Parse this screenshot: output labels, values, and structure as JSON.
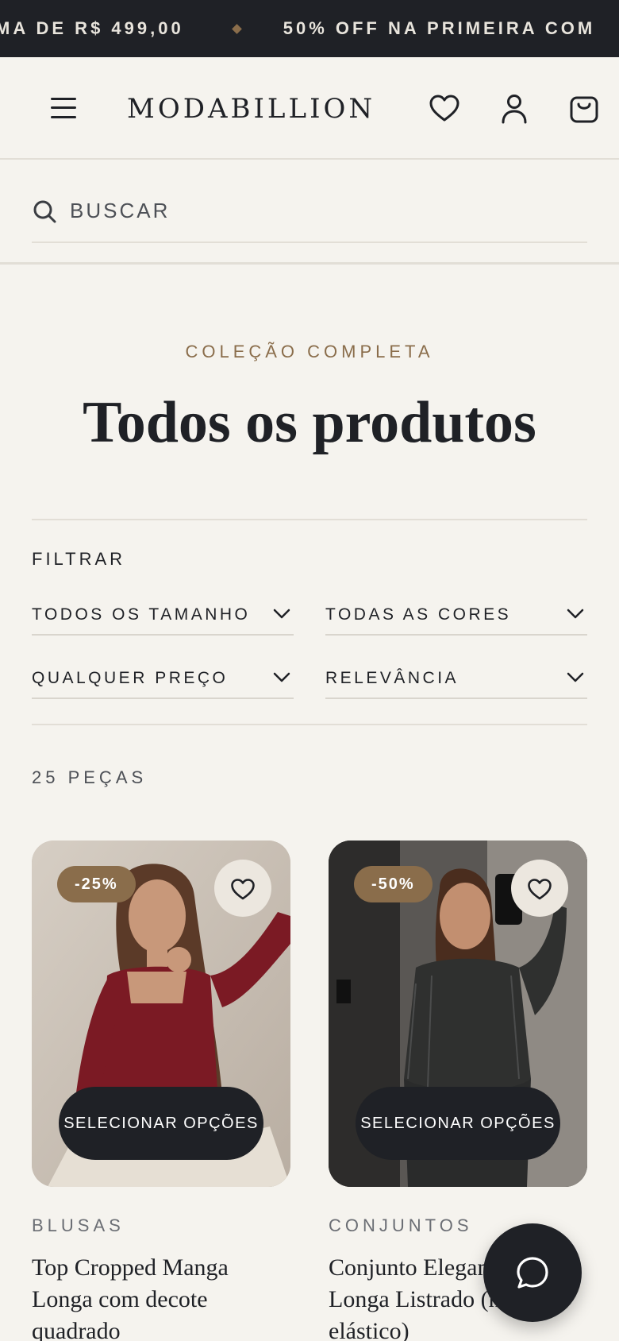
{
  "announcement": {
    "left_text": "MA DE R$ 499,00",
    "right_text": "50% OFF NA PRIMEIRA COM"
  },
  "header": {
    "logo": "MODABILLION",
    "icons": [
      "menu-icon",
      "heart-icon",
      "user-icon",
      "bag-icon"
    ]
  },
  "search": {
    "placeholder": "BUSCAR"
  },
  "collection": {
    "eyebrow": "COLEÇÃO COMPLETA",
    "title": "Todos os produtos"
  },
  "filters": {
    "label": "FILTRAR",
    "size": "TODOS OS TAMANHO",
    "color": "TODAS AS CORES",
    "price": "QUALQUER PREÇO",
    "sort": "RELEVÂNCIA"
  },
  "results": {
    "count": "25 PEÇAS"
  },
  "products": [
    {
      "badge": "-25%",
      "action": "SELECIONAR OPÇÕES",
      "category": "BLUSAS",
      "name": "Top Cropped Manga Longa com decote quadrado"
    },
    {
      "badge": "-50%",
      "action": "SELECIONAR OPÇÕES",
      "category": "CONJUNTOS",
      "name": "Conjunto Elegante Manga Longa Listrado (não elástico)"
    }
  ],
  "colors": {
    "dark": "#1f2126",
    "accent": "#8a6d4b",
    "background": "#f5f3ee"
  }
}
